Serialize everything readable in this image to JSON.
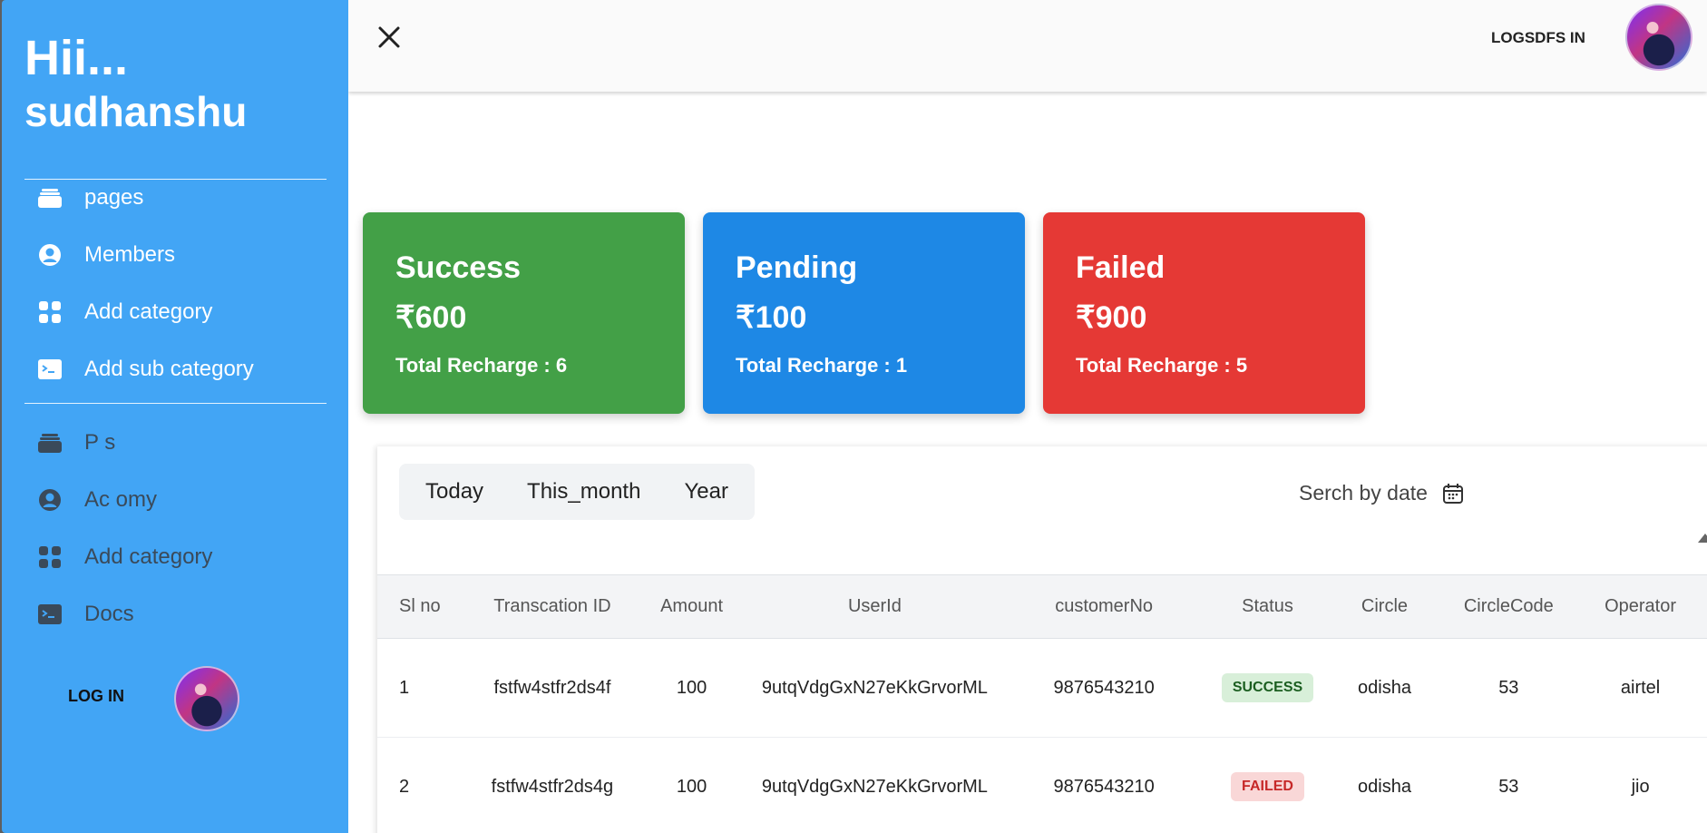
{
  "sidebar": {
    "greeting": "Hii...",
    "username": "sudhanshu",
    "items": [
      {
        "label": "pages",
        "icon": "stack-icon"
      },
      {
        "label": "Members",
        "icon": "user-circle-icon"
      },
      {
        "label": "Add category",
        "icon": "grid-icon"
      },
      {
        "label": "Add sub category",
        "icon": "terminal-icon"
      }
    ],
    "secondary_items": [
      {
        "label": "P s",
        "icon": "stack-icon"
      },
      {
        "label": "Ac omy",
        "icon": "user-circle-icon"
      },
      {
        "label": "Add category",
        "icon": "grid-icon"
      },
      {
        "label": "Docs",
        "icon": "terminal-icon"
      }
    ],
    "login_label": "LOG IN"
  },
  "header": {
    "login_label": "LOGSDFS IN"
  },
  "cards": [
    {
      "title": "Success",
      "amount": "₹600",
      "total": "Total Recharge : 6",
      "color": "#43a047"
    },
    {
      "title": "Pending",
      "amount": "₹100",
      "total": "Total Recharge : 1",
      "color": "#1e88e5"
    },
    {
      "title": "Failed",
      "amount": "₹900",
      "total": "Total Recharge : 5",
      "color": "#e53935"
    }
  ],
  "filters": {
    "tabs": [
      "Today",
      "This_month",
      "Year"
    ],
    "search_date_label": "Serch by date"
  },
  "table": {
    "columns": [
      "Sl no",
      "Transcation ID",
      "Amount",
      "UserId",
      "customerNo",
      "Status",
      "Circle",
      "CircleCode",
      "Operator"
    ],
    "rows": [
      {
        "sl": "1",
        "txn": "fstfw4stfr2ds4f",
        "amount": "100",
        "userId": "9utqVdgGxN27eKkGrvorML",
        "customerNo": "9876543210",
        "status": "SUCCESS",
        "circle": "odisha",
        "circleCode": "53",
        "operator": "airtel"
      },
      {
        "sl": "2",
        "txn": "fstfw4stfr2ds4g",
        "amount": "100",
        "userId": "9utqVdgGxN27eKkGrvorML",
        "customerNo": "9876543210",
        "status": "FAILED",
        "circle": "odisha",
        "circleCode": "53",
        "operator": "jio"
      }
    ]
  }
}
